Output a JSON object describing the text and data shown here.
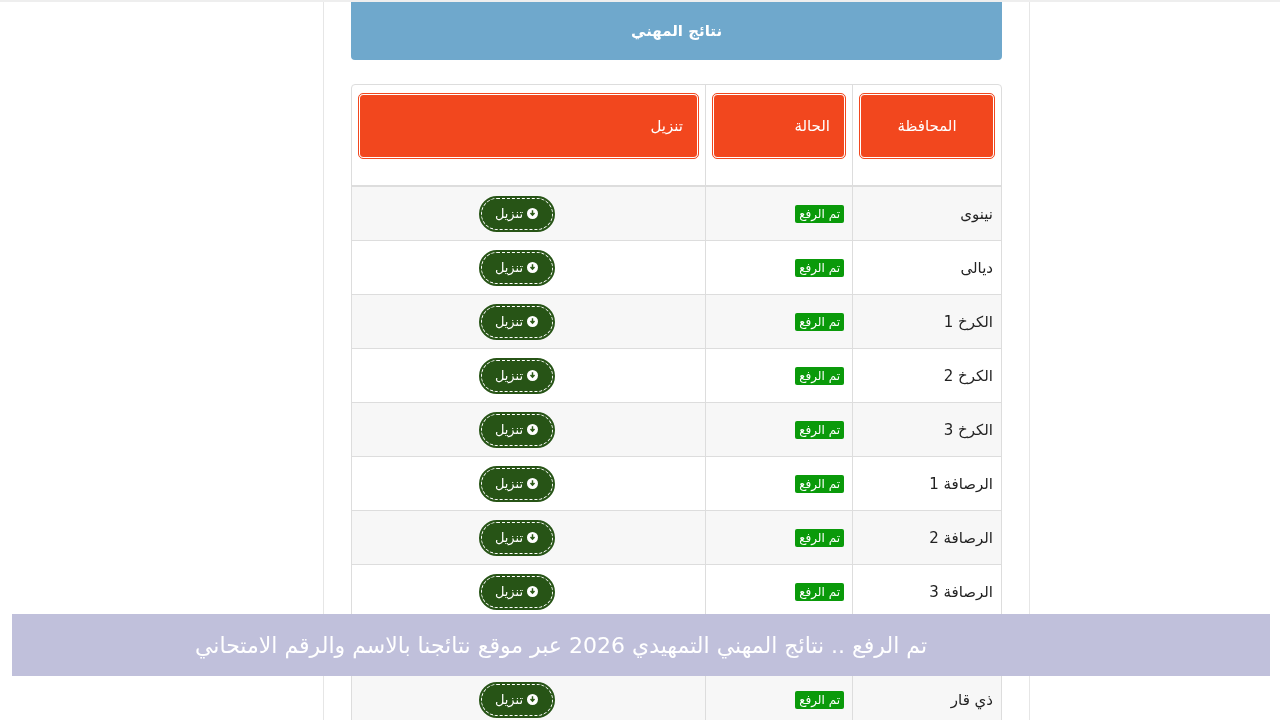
{
  "title": "نتائج المهني",
  "table": {
    "columns": [
      "المحافظة",
      "الحالة",
      "تنزيل"
    ],
    "rows": [
      {
        "province": "نينوى",
        "status": "تم الرفع",
        "action": "تنزيل"
      },
      {
        "province": "ديالى",
        "status": "تم الرفع",
        "action": "تنزيل"
      },
      {
        "province": "الكرخ 1",
        "status": "تم الرفع",
        "action": "تنزيل"
      },
      {
        "province": "الكرخ 2",
        "status": "تم الرفع",
        "action": "تنزيل"
      },
      {
        "province": "الكرخ 3",
        "status": "تم الرفع",
        "action": "تنزيل"
      },
      {
        "province": "الرصافة 1",
        "status": "تم الرفع",
        "action": "تنزيل"
      },
      {
        "province": "الرصافة 2",
        "status": "تم الرفع",
        "action": "تنزيل"
      },
      {
        "province": "الرصافة 3",
        "status": "تم الرفع",
        "action": "تنزيل"
      },
      {
        "province": "ذي قار",
        "status": "تم الرفع",
        "action": "تنزيل"
      }
    ]
  },
  "caption": "تم الرفع .. نتائج المهني التمهيدي 2026 عبر موقع نتائجنا بالاسم والرقم الامتحاني"
}
